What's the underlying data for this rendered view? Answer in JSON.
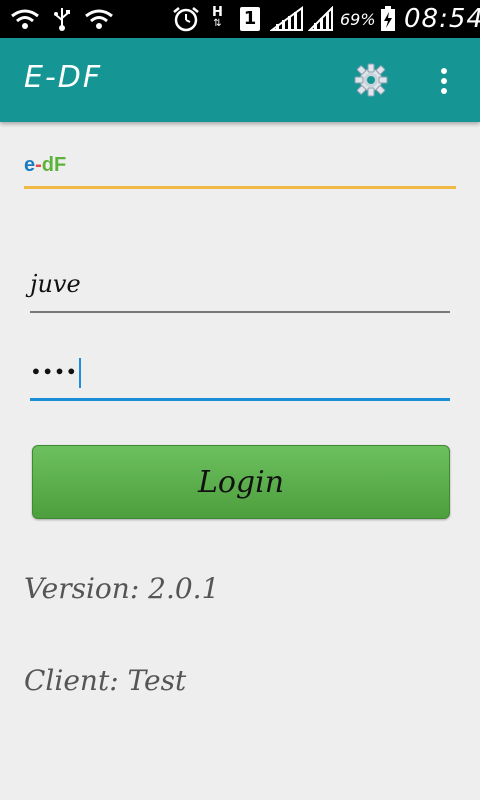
{
  "status_bar": {
    "icons": [
      "wifi-icon",
      "usb-icon",
      "wifi-icon",
      "alarm-icon",
      "h-network-icon",
      "sim-1-icon",
      "signal-icon",
      "signal-icon",
      "battery-charging-icon"
    ],
    "network_letter": "H",
    "sim_number": "1",
    "battery_percent": "69%",
    "time": "08:54"
  },
  "app_bar": {
    "title": "E-DF",
    "color": "#159594",
    "icons": [
      "gear-icon",
      "overflow-menu-icon"
    ]
  },
  "logo": {
    "e": "e",
    "dash": "-",
    "df": "dF"
  },
  "form": {
    "username_value": "juve",
    "password_value": "••••",
    "login_label": "Login"
  },
  "info": {
    "version": "Version: 2.0.1",
    "client": "Client: Test"
  },
  "colors": {
    "accent_line": "#f0b944",
    "focused_line": "#1a8ed6",
    "button_green": "#5cb04c"
  }
}
